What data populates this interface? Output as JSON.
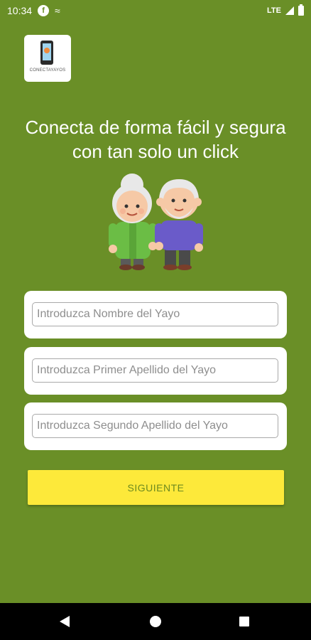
{
  "status_bar": {
    "time": "10:34",
    "notification_icons": [
      "f-app-icon",
      "wave-notification-icon"
    ],
    "network": "LTE",
    "icons": [
      "signal-icon",
      "battery-icon"
    ]
  },
  "logo": {
    "text": "CONECTAYAYOS",
    "icon": "phone-icon"
  },
  "headline": "Conecta de forma fácil y segura con tan solo un click",
  "illustration": {
    "icon": "grandparents-icon",
    "colors": {
      "grandma_outfit": "#6bbd45",
      "grandpa_outfit": "#6a5bc9",
      "skin": "#f6c9a6",
      "hair": "#e8e8e8"
    }
  },
  "form": {
    "first_name_placeholder": "Introduzca Nombre del Yayo",
    "first_surname_placeholder": "Introduzca Primer Apellido del Yayo",
    "second_surname_placeholder": "Introduzca Segundo Apellido del Yayo",
    "first_name_value": "",
    "first_surname_value": "",
    "second_surname_value": ""
  },
  "next_button": {
    "label": "SIGUIENTE"
  },
  "nav_bar": {
    "icons": [
      "back-icon",
      "home-icon",
      "recent-apps-icon"
    ]
  },
  "colors": {
    "background": "#6a8f27",
    "button": "#fde93a",
    "button_text": "#6d8a1f"
  }
}
